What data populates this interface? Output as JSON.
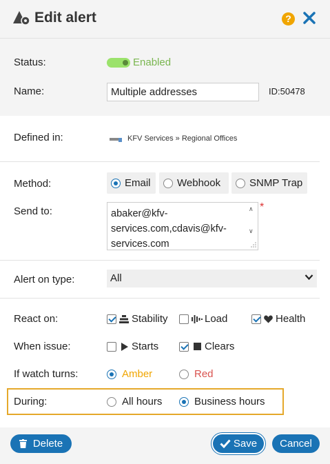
{
  "header": {
    "title": "Edit alert",
    "help_label": "?"
  },
  "status": {
    "label": "Status:",
    "value": "Enabled"
  },
  "name": {
    "label": "Name:",
    "value": "Multiple addresses",
    "id_text": "ID:50478"
  },
  "defined_in": {
    "label": "Defined in:",
    "path": "KFV Services » Regional Offices"
  },
  "method": {
    "label": "Method:",
    "options": [
      "Email",
      "Webhook",
      "SNMP Trap"
    ],
    "selected": "Email"
  },
  "send_to": {
    "label": "Send to:",
    "lines": [
      "abaker@kfv-",
      "services.com,cdavis@kfv-",
      "services.com"
    ],
    "required_mark": "*"
  },
  "alert_type": {
    "label": "Alert on type:",
    "value": "All"
  },
  "react_on": {
    "label": "React on:",
    "options": [
      {
        "label": "Stability",
        "checked": true,
        "icon": "stability-icon"
      },
      {
        "label": "Load",
        "checked": false,
        "icon": "load-icon"
      },
      {
        "label": "Health",
        "checked": true,
        "icon": "heart-icon"
      }
    ]
  },
  "when_issue": {
    "label": "When issue:",
    "options": [
      {
        "label": "Starts",
        "checked": false,
        "icon": "play-icon"
      },
      {
        "label": "Clears",
        "checked": true,
        "icon": "stop-icon"
      }
    ]
  },
  "watch_turns": {
    "label": "If watch turns:",
    "options": [
      "Amber",
      "Red"
    ],
    "selected": "Amber"
  },
  "during": {
    "label": "During:",
    "options": [
      "All hours",
      "Business hours"
    ],
    "selected": "Business hours"
  },
  "footer": {
    "delete_label": "Delete",
    "save_label": "Save",
    "cancel_label": "Cancel"
  },
  "colors": {
    "primary": "#1a73b5",
    "amber": "#f0a500",
    "red": "#d9534f",
    "enabled": "#7ab650",
    "highlight": "#e5a82a"
  }
}
